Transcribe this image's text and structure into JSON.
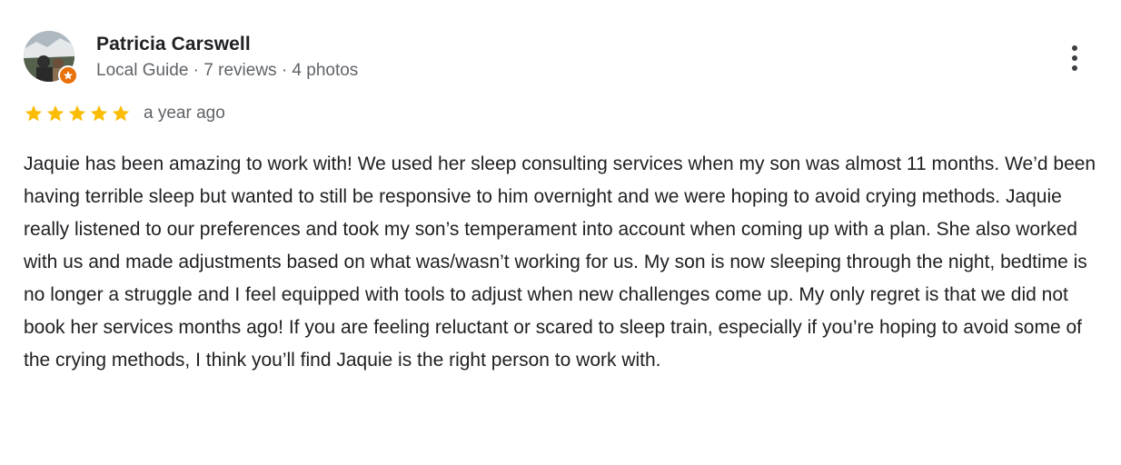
{
  "author": {
    "name": "Patricia Carswell",
    "meta": "Local Guide · 7 reviews · 4 photos",
    "badge_icon": "local-guide-star-icon",
    "badge_color": "#e8710a"
  },
  "rating": {
    "stars": 5,
    "max_stars": 5,
    "star_color": "#fbbc04",
    "date": "a year ago"
  },
  "review": {
    "text": "Jaquie has been amazing to work with! We used her sleep consulting services when my son was almost 11 months. We’d been having terrible sleep but wanted to still be responsive to him overnight and we were hoping to avoid crying methods. Jaquie really listened to our preferences and took my son’s temperament into account when coming up with a plan. She also worked with us and made adjustments based on what was/wasn’t working for us. My son is now sleeping through the night, bedtime is no longer a struggle and I feel equipped with tools to adjust when new challenges come up. My only regret is that we did not book her services months ago! If you are feeling reluctant or scared to sleep train, especially if you’re hoping to avoid some of the crying methods, I think you’ll find Jaquie is the right person to work with."
  },
  "menu": {
    "icon": "more-vertical-icon"
  }
}
